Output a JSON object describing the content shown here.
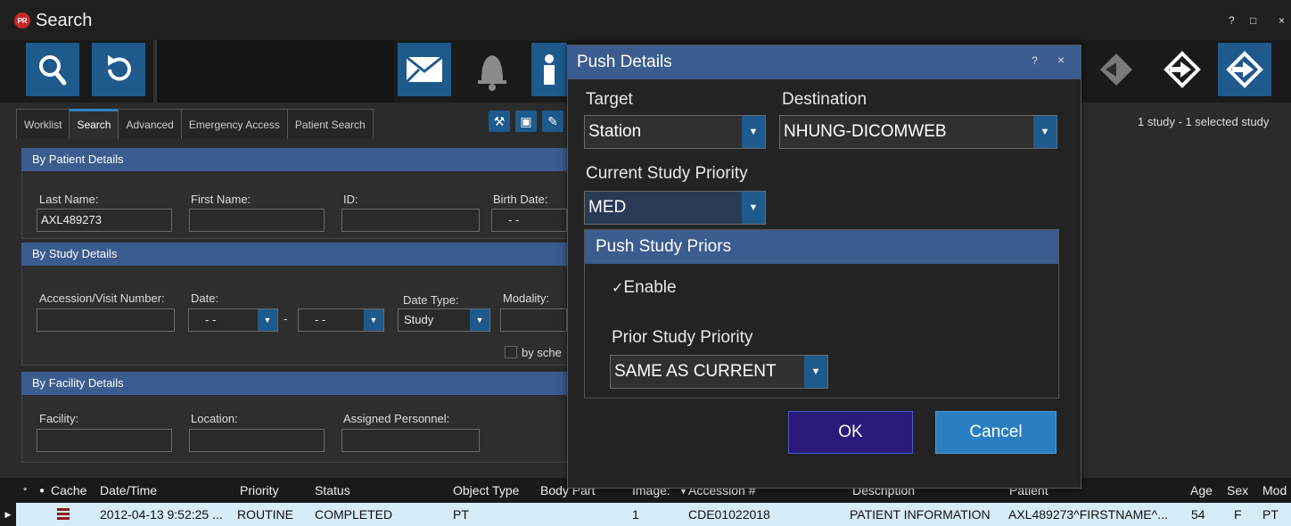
{
  "window": {
    "title": "Search",
    "logo_text": "PR",
    "help": "?",
    "maximize": "□",
    "close": "×"
  },
  "tabs": [
    {
      "label": "Worklist"
    },
    {
      "label": "Search"
    },
    {
      "label": "Advanced"
    },
    {
      "label": "Emergency Access"
    },
    {
      "label": "Patient Search"
    }
  ],
  "status_summary": "1 study - 1 selected study",
  "patient_section": {
    "title": "By Patient Details",
    "last_name_label": "Last Name:",
    "last_name_value": "AXL489273",
    "first_name_label": "First Name:",
    "id_label": "ID:",
    "birth_date_label": "Birth Date:",
    "birth_date_value": "- -"
  },
  "study_section": {
    "title": "By Study Details",
    "accession_label": "Accession/Visit Number:",
    "date_label": "Date:",
    "date_from": "- -",
    "date_sep": "-",
    "date_to": "- -",
    "date_type_label": "Date Type:",
    "date_type_value": "Study",
    "modality_label": "Modality:",
    "scheduled_label": "by sche"
  },
  "facility_section": {
    "title": "By Facility Details",
    "facility_label": "Facility:",
    "location_label": "Location:",
    "assigned_label": "Assigned Personnel:"
  },
  "grid": {
    "headers": {
      "star": "*",
      "cache": "Cache",
      "datetime": "Date/Time",
      "priority": "Priority",
      "status": "Status",
      "object_type": "Object Type",
      "body_part": "Body Part",
      "images": "Image:",
      "accession": "Accession #",
      "description": "Description",
      "patient": "Patient",
      "age": "Age",
      "sex": "Sex",
      "modality": "Mod"
    },
    "rows": [
      {
        "datetime": "2012-04-13 9:52:25 ...",
        "priority": "ROUTINE",
        "status": "COMPLETED",
        "object_type": "PT",
        "images": "1",
        "accession": "CDE01022018",
        "description": "PATIENT INFORMATION",
        "patient": "AXL489273^FIRSTNAME^...",
        "age": "54",
        "sex": "F",
        "modality": "PT"
      }
    ]
  },
  "dialog": {
    "title": "Push Details",
    "help": "?",
    "close": "×",
    "target_label": "Target",
    "target_value": "Station",
    "destination_label": "Destination",
    "destination_value": "NHUNG-DICOMWEB",
    "current_priority_label": "Current Study Priority",
    "current_priority_value": "MED",
    "priors_title": "Push Study Priors",
    "enable_label": "Enable",
    "enable_checked": true,
    "prior_priority_label": "Prior Study Priority",
    "prior_priority_value": "SAME AS CURRENT",
    "ok_label": "OK",
    "cancel_label": "Cancel"
  },
  "colors": {
    "accent_blue": "#1e5a8c",
    "header_blue": "#3b5c8e",
    "ok_button": "#2a1a7a",
    "cancel_button": "#2a7fc2",
    "selected_row": "#d6ecf8"
  }
}
